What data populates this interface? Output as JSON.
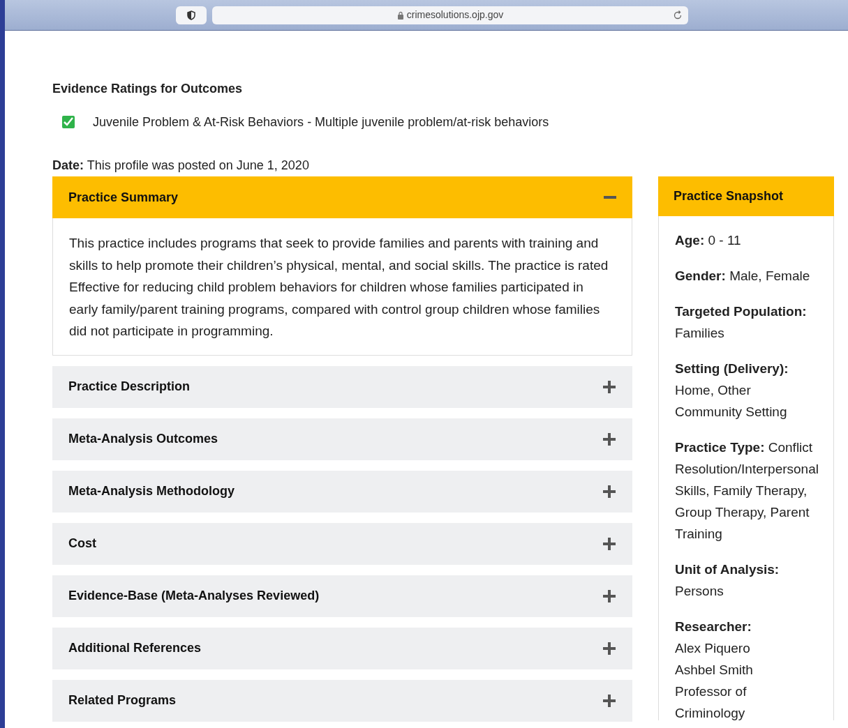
{
  "browser": {
    "url": "crimesolutions.ojp.gov"
  },
  "outcomes_heading": "Evidence Ratings for Outcomes",
  "outcomes": [
    {
      "text": "Juvenile Problem & At-Risk Behaviors - Multiple juvenile problem/at-risk behaviors",
      "checked": true
    }
  ],
  "date": {
    "label": "Date:",
    "text": "This profile was posted on June 1, 2020"
  },
  "sections": [
    {
      "title": "Practice Summary",
      "expanded": true,
      "body": "This practice includes programs that seek to provide families and parents with training and skills to help promote their children’s physical, mental, and social skills. The practice is rated Effective for reducing child problem behaviors for children whose families participated in early family/parent training programs, compared with control group children whose families did not participate in programming."
    },
    {
      "title": "Practice Description",
      "expanded": false
    },
    {
      "title": "Meta-Analysis Outcomes",
      "expanded": false
    },
    {
      "title": "Meta-Analysis Methodology",
      "expanded": false
    },
    {
      "title": "Cost",
      "expanded": false
    },
    {
      "title": "Evidence-Base (Meta-Analyses Reviewed)",
      "expanded": false
    },
    {
      "title": "Additional References",
      "expanded": false
    },
    {
      "title": "Related Programs",
      "expanded": false
    }
  ],
  "snapshot": {
    "title": "Practice Snapshot",
    "fields": [
      {
        "label": "Age:",
        "value": "0 - 11"
      },
      {
        "label": "Gender:",
        "value": "Male, Female"
      },
      {
        "label": "Targeted Population:",
        "value": "Families"
      },
      {
        "label": "Setting (Delivery):",
        "value": "Home, Other Community Setting"
      },
      {
        "label": "Practice Type:",
        "value": "Conflict Resolution/Interpersonal Skills, Family Therapy, Group Therapy, Parent Training"
      },
      {
        "label": "Unit of Analysis:",
        "value": "Persons"
      },
      {
        "label": "Researcher:",
        "lines": [
          "Alex Piquero",
          "Ashbel Smith",
          "Professor of",
          "Criminology"
        ]
      }
    ]
  }
}
